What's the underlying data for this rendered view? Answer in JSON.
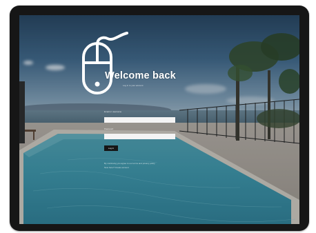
{
  "login": {
    "title": "Welcome back",
    "subtitle": "Log in to your account",
    "email_label": "Email or username",
    "email_value": "",
    "password_label": "Password",
    "password_value": "",
    "submit_label": "Log in",
    "terms_text": "By continuing you agree to our terms and privacy policy",
    "signup_text": "New here? Create account"
  },
  "overlay_icon": "computer-mouse-icon",
  "colors": {
    "tablet_frame": "#161616",
    "input_background": "#f4f4f4",
    "button_background": "#161616",
    "icon_stroke": "#ffffff"
  }
}
